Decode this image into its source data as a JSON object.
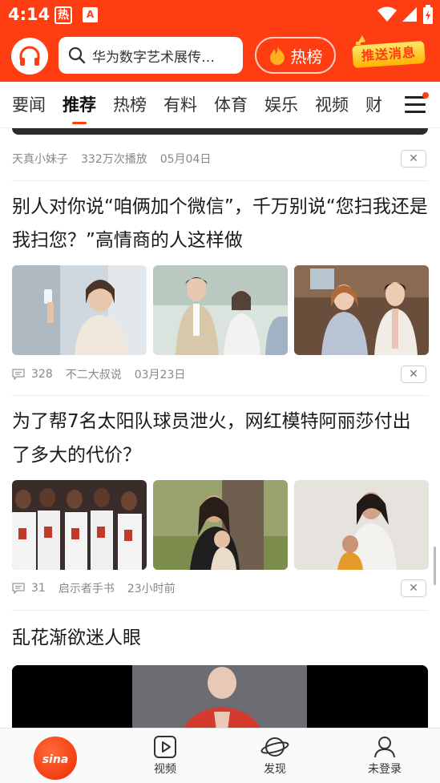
{
  "status_bar": {
    "time": "4:14",
    "hot_label": "热",
    "a_label": "A"
  },
  "header": {
    "search_placeholder": "华为数字艺术展传…",
    "hot_list_label": "热榜",
    "push_badge_label": "推送消息"
  },
  "tabs": [
    {
      "label": "要闻",
      "active": false
    },
    {
      "label": "推荐",
      "active": true
    },
    {
      "label": "热榜",
      "active": false
    },
    {
      "label": "有料",
      "active": false
    },
    {
      "label": "体育",
      "active": false
    },
    {
      "label": "娱乐",
      "active": false
    },
    {
      "label": "视频",
      "active": false
    },
    {
      "label": "财",
      "active": false
    }
  ],
  "feed": {
    "prev_item": {
      "author": "天真小妹子",
      "plays": "332万次播放",
      "date": "05月04日"
    },
    "articles": [
      {
        "title": "别人对你说“咱俩加个微信”，千万别说“您扫我还是我扫您？”高情商的人这样做",
        "comments": "328",
        "author": "不二大叔说",
        "date": "03月23日"
      },
      {
        "title": "为了帮7名太阳队球员泄火，网红模特阿丽莎付出了多大的代价？",
        "comments": "31",
        "author": "启示者手书",
        "date": "23小时前"
      },
      {
        "title": "乱花渐欲迷人眼"
      }
    ],
    "close_label": "✕"
  },
  "bottom_nav": {
    "home_label": "sina",
    "video": "视频",
    "discover": "发现",
    "login": "未登录"
  },
  "colors": {
    "brand": "#ff3d12",
    "badge": "#ffc21a"
  }
}
